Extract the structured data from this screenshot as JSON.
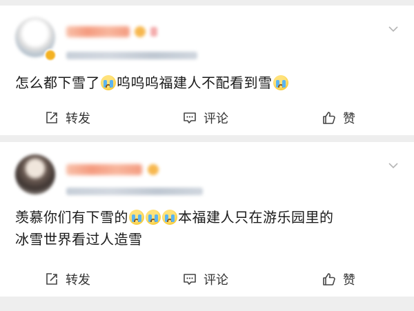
{
  "posts": [
    {
      "content_parts": [
        "怎么都下雪了",
        "呜呜呜福建人不配看到雪",
        ""
      ],
      "actions": {
        "repost": "转发",
        "comment": "评论",
        "like": "赞"
      }
    },
    {
      "content_line1": [
        "羡慕你们有下雪的",
        "本福建人只在游乐园里的"
      ],
      "content_line2": "冰雪世界看过人造雪",
      "actions": {
        "repost": "转发",
        "comment": "评论",
        "like": "赞"
      }
    }
  ],
  "icons": {
    "repost": "repost-icon",
    "comment": "comment-icon",
    "like": "thumbs-up-icon",
    "more": "chevron-down-icon",
    "emoji": "crying-emoji-icon"
  },
  "colors": {
    "background": "#eeeeee",
    "card": "#ffffff",
    "text": "#1a1a1a",
    "action_text": "#333333",
    "emoji_face": "#f7c934",
    "emoji_tears": "#5bb4f0"
  }
}
